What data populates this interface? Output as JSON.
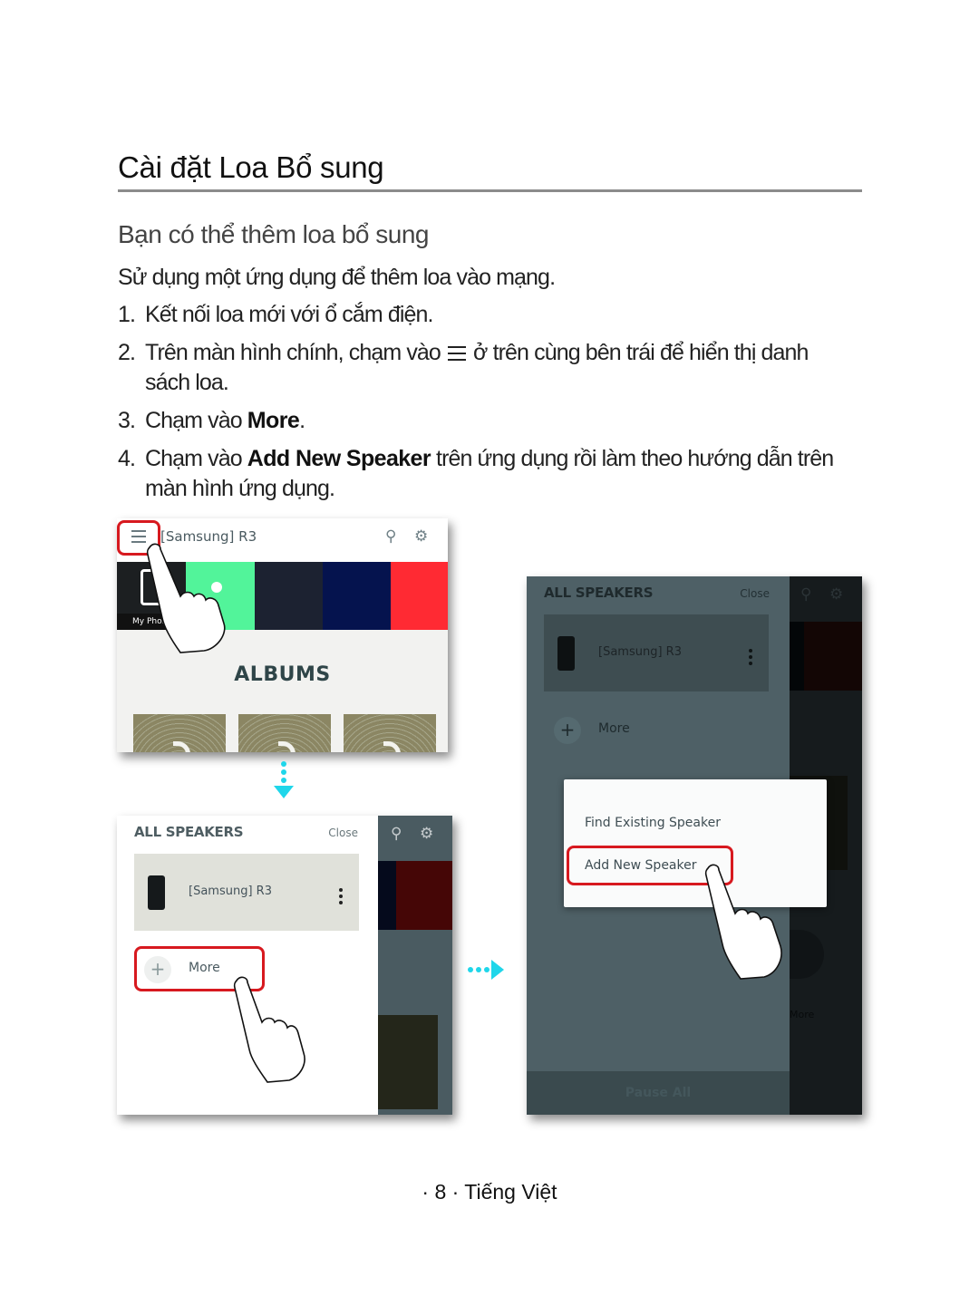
{
  "page": {
    "title": "Cài đặt Loa Bổ sung",
    "subtitle": "Bạn có thể thêm loa bổ sung",
    "intro": "Sử dụng một ứng dụng để thêm loa vào mạng.",
    "steps": [
      {
        "num": "1.",
        "text": "Kết nối loa mới với ổ cắm điện."
      },
      {
        "num": "2.",
        "text_before": "Trên màn hình chính, chạm vào",
        "icon": "menu-icon",
        "text_after": "ở trên cùng bên trái để hiển thị danh sách loa."
      },
      {
        "num": "3.",
        "text_before": "Chạm vào ",
        "bold": "More",
        "text_after": "."
      },
      {
        "num": "4.",
        "text_before": "Chạm vào ",
        "bold": "Add New Speaker",
        "text_after": " trên ứng dụng rồi làm theo hướng dẫn trên màn hình ứng dụng."
      }
    ],
    "footer": "· 8 · Tiếng Việt"
  },
  "screen1": {
    "title": "[Samsung] R3",
    "tiles": [
      {
        "label": "My Phone",
        "color": "#1c1f21"
      },
      {
        "label": "",
        "color": "#52f49a"
      },
      {
        "label": "",
        "color": "#1c2231"
      },
      {
        "label": "",
        "color": "#05134e"
      },
      {
        "label": "",
        "color": "#ff2a33"
      }
    ],
    "section": "ALBUMS",
    "icons": [
      "search-icon",
      "settings-icon"
    ]
  },
  "screen2": {
    "header": "ALL SPEAKERS",
    "close": "Close",
    "speaker": "[Samsung] R3",
    "more": "More"
  },
  "screen3": {
    "header": "ALL SPEAKERS",
    "close": "Close",
    "speaker": "[Samsung] R3",
    "more": "More",
    "popup": [
      "Find Existing Speaker",
      "Add New Speaker"
    ],
    "pause_all": "Pause All",
    "bg_more": "More"
  },
  "colors": {
    "highlight": "#d7191f",
    "arrow": "#1fd6ea"
  }
}
